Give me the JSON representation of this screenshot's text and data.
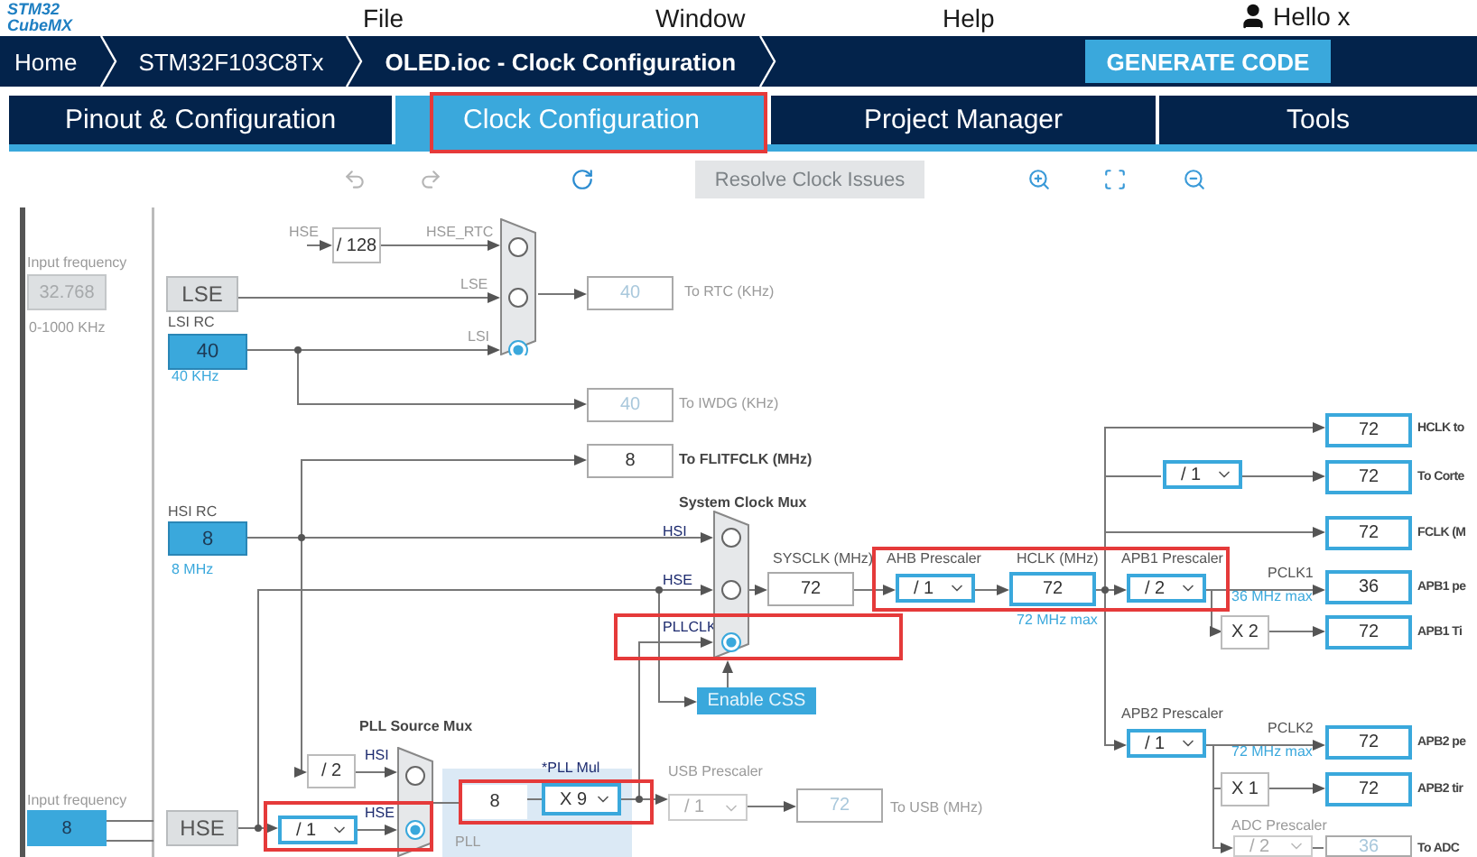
{
  "menu_bar": {
    "logo": [
      "STM32",
      "CubeMX"
    ],
    "items": [
      "File",
      "Window",
      "Help"
    ],
    "user": "Hello x"
  },
  "breadcrumbs": [
    {
      "label": "Home",
      "current": false
    },
    {
      "label": "STM32F103C8Tx",
      "current": false
    },
    {
      "label": "OLED.ioc - Clock Configuration",
      "current": true
    }
  ],
  "generate_button": "GENERATE CODE",
  "tabs": [
    {
      "label": "Pinout & Configuration",
      "selected": false
    },
    {
      "label": "Clock Configuration",
      "selected": true
    },
    {
      "label": "Project Manager",
      "selected": false
    },
    {
      "label": "Tools",
      "selected": false
    }
  ],
  "toolbar": {
    "resolve_button": {
      "label": "Resolve Clock Issues",
      "disabled": true
    }
  },
  "diagram": {
    "labels": [
      {
        "text": "Input frequency",
        "kind": "muted"
      },
      {
        "text": "0-1000 KHz",
        "kind": "muted"
      },
      {
        "text": "HSE",
        "kind": "muted"
      },
      {
        "text": "HSE_RTC",
        "kind": "muted"
      },
      {
        "text": "LSE",
        "kind": "muted"
      },
      {
        "text": "LSI RC",
        "kind": "dark"
      },
      {
        "text": "LSI",
        "kind": "muted"
      },
      {
        "text": "40 KHz",
        "kind": "blue"
      },
      {
        "text": "To RTC (KHz)",
        "kind": "muted"
      },
      {
        "text": "To IWDG (KHz)",
        "kind": "muted"
      },
      {
        "text": "To FLITFCLK (MHz)",
        "kind": "bold"
      },
      {
        "text": "HSI RC",
        "kind": "dark"
      },
      {
        "text": "System Clock Mux",
        "kind": "bold"
      },
      {
        "text": "HSI",
        "kind": "navy"
      },
      {
        "text": "HSE",
        "kind": "navy"
      },
      {
        "text": "PLLCLK",
        "kind": "navy"
      },
      {
        "text": "8 MHz",
        "kind": "blue"
      },
      {
        "text": "SYSCLK (MHz)",
        "kind": "dark"
      },
      {
        "text": "AHB Prescaler",
        "kind": "dark"
      },
      {
        "text": "HCLK (MHz)",
        "kind": "dark"
      },
      {
        "text": "APB1 Prescaler",
        "kind": "dark"
      },
      {
        "text": "PCLK1",
        "kind": "dark"
      },
      {
        "text": "36 MHz max",
        "kind": "blue"
      },
      {
        "text": "72 MHz max",
        "kind": "blue"
      },
      {
        "text": "HCLK to",
        "kind": "bold"
      },
      {
        "text": "To Corte",
        "kind": "bold"
      },
      {
        "text": "FCLK (M",
        "kind": "bold"
      },
      {
        "text": "APB1 pe",
        "kind": "bold"
      },
      {
        "text": "APB1 Ti",
        "kind": "bold"
      },
      {
        "text": "APB2 Prescaler",
        "kind": "dark"
      },
      {
        "text": "PCLK2",
        "kind": "dark"
      },
      {
        "text": "72 MHz max",
        "kind": "blue"
      },
      {
        "text": "APB2 pe",
        "kind": "bold"
      },
      {
        "text": "APB2 tir",
        "kind": "bold"
      },
      {
        "text": "ADC Prescaler",
        "kind": "muted"
      },
      {
        "text": "To ADC",
        "kind": "bold"
      },
      {
        "text": "PLL Source Mux",
        "kind": "bold"
      },
      {
        "text": "HSI",
        "kind": "navy"
      },
      {
        "text": "HSE",
        "kind": "navy"
      },
      {
        "text": "Input frequency",
        "kind": "muted"
      },
      {
        "text": "*PLL Mul",
        "kind": "navy"
      },
      {
        "text": "PLL",
        "kind": "muted"
      },
      {
        "text": "USB Prescaler",
        "kind": "muted"
      },
      {
        "text": "To USB (MHz)",
        "kind": "muted"
      }
    ],
    "boxes": [
      {
        "kind": "input",
        "text": "32.768",
        "active": false
      },
      {
        "kind": "source",
        "text": "LSE",
        "active": false
      },
      {
        "kind": "source",
        "text": "40",
        "active": true
      },
      {
        "kind": "factor",
        "text": "/ 128"
      },
      {
        "kind": "value",
        "text": "40",
        "disabled": true,
        "highlight": false
      },
      {
        "kind": "value",
        "text": "40",
        "disabled": true,
        "highlight": false
      },
      {
        "kind": "value",
        "text": "72",
        "disabled": false,
        "highlight": true
      },
      {
        "kind": "value",
        "text": "8",
        "disabled": false,
        "highlight": false
      },
      {
        "kind": "dropdown",
        "text": "/ 1",
        "disabled": false
      },
      {
        "kind": "value",
        "text": "72",
        "disabled": false,
        "highlight": true
      },
      {
        "kind": "value",
        "text": "72",
        "disabled": false,
        "highlight": true
      },
      {
        "kind": "source",
        "text": "8",
        "active": true
      },
      {
        "kind": "value",
        "text": "72",
        "disabled": false,
        "highlight": false
      },
      {
        "kind": "dropdown",
        "text": "/ 1",
        "disabled": false
      },
      {
        "kind": "value",
        "text": "72",
        "disabled": false,
        "highlight": true
      },
      {
        "kind": "dropdown",
        "text": "/ 2",
        "disabled": false
      },
      {
        "kind": "value",
        "text": "36",
        "disabled": false,
        "highlight": true
      },
      {
        "kind": "factor",
        "text": "X 2"
      },
      {
        "kind": "value",
        "text": "72",
        "disabled": false,
        "highlight": true
      },
      {
        "kind": "dropdown",
        "text": "/ 1",
        "disabled": false
      },
      {
        "kind": "value",
        "text": "72",
        "disabled": false,
        "highlight": true
      },
      {
        "kind": "factor",
        "text": "X 1"
      },
      {
        "kind": "value",
        "text": "72",
        "disabled": false,
        "highlight": true
      },
      {
        "kind": "dropdown",
        "text": "/ 2",
        "disabled": true
      },
      {
        "kind": "value",
        "text": "36",
        "disabled": true,
        "highlight": false
      },
      {
        "kind": "factor",
        "text": "/ 2"
      },
      {
        "kind": "input",
        "text": "8",
        "active": true
      },
      {
        "kind": "source",
        "text": "HSE",
        "active": false
      },
      {
        "kind": "dropdown",
        "text": "/ 1",
        "disabled": false
      },
      {
        "kind": "plain",
        "text": "8"
      },
      {
        "kind": "dropdown",
        "text": "X 9",
        "disabled": false
      },
      {
        "kind": "dropdown",
        "text": "/ 1",
        "disabled": true
      },
      {
        "kind": "value",
        "text": "72",
        "disabled": true,
        "highlight": false
      }
    ],
    "muxes": [
      {
        "inputs": [
          {
            "selected": false
          },
          {
            "selected": false
          },
          {
            "selected": true
          }
        ]
      },
      {
        "inputs": [
          {
            "selected": false
          },
          {
            "selected": false
          },
          {
            "selected": true
          }
        ]
      },
      {
        "inputs": [
          {
            "selected": false
          },
          {
            "selected": true
          }
        ]
      }
    ],
    "css_button": "Enable CSS"
  }
}
